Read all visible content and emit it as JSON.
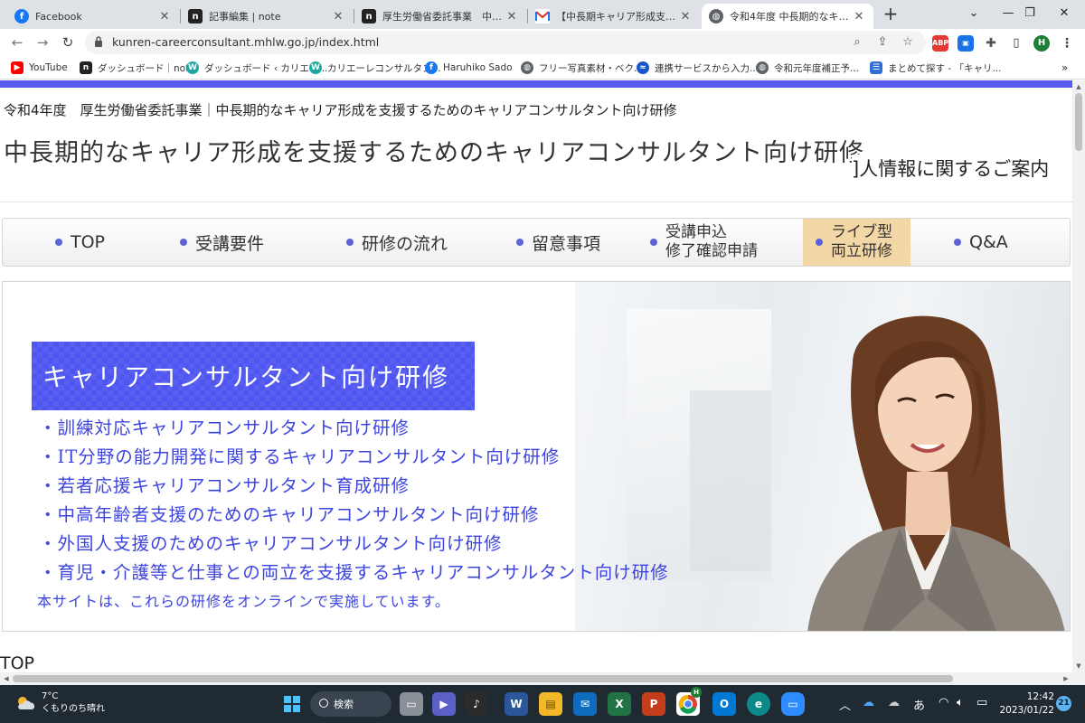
{
  "browser": {
    "tabs": [
      {
        "title": "Facebook",
        "icon": "facebook-icon",
        "color": "#1877f2"
      },
      {
        "title": "記事編集 | note",
        "icon": "note-icon",
        "color": "#222222"
      },
      {
        "title": "厚生労働省委託事業　中長期",
        "icon": "note-icon",
        "color": "#222222"
      },
      {
        "title": "【中長期キャリア形成支援研修】",
        "icon": "gmail-icon",
        "color": "#d93025"
      },
      {
        "title": "令和4年度 中長期的なキャリア",
        "icon": "globe-icon",
        "color": "#5f6368"
      }
    ],
    "active_tab_index": 4,
    "url": "kunren-careerconsultant.mhlw.go.jp/index.html",
    "profile_initial": "H",
    "extension_abp": "ABP",
    "bookmarks": [
      {
        "label": "YouTube",
        "icon": "youtube-icon",
        "color": "#ff0000"
      },
      {
        "label": "ダッシュボード｜note",
        "icon": "note-icon",
        "color": "#222222"
      },
      {
        "label": "ダッシュボード ‹ カリエー...",
        "icon": "wordpress-icon",
        "color": "#20a8a0"
      },
      {
        "label": "カリエーレコンサルタン...",
        "icon": "wordpress-icon",
        "color": "#20a8a0"
      },
      {
        "label": "Haruhiko Sado",
        "icon": "facebook-icon",
        "color": "#1877f2"
      },
      {
        "label": "フリー写真素材・ベク...",
        "icon": "globe-icon",
        "color": "#5f6368"
      },
      {
        "label": "連携サービスから入力...",
        "icon": "service-icon",
        "color": "#1a56c9"
      },
      {
        "label": "令和元年度補正予...",
        "icon": "globe-icon",
        "color": "#5f6368"
      },
      {
        "label": "まとめて探す - 「キャリ...",
        "icon": "search-app-icon",
        "color": "#2f6fd6"
      }
    ]
  },
  "site": {
    "subtitle": "令和4年度　厚生労働省委託事業｜中長期的なキャリア形成を支援するためのキャリアコンサルタント向け研修",
    "title": "中長期的なキャリア形成を支援するためのキャリアコンサルタント向け研修",
    "ticker": "]人情報に関するご案内",
    "accent_color": "#5b5bf0",
    "nav": [
      {
        "label": "TOP"
      },
      {
        "label": "受講要件"
      },
      {
        "label": "研修の流れ"
      },
      {
        "label": "留意事項"
      },
      {
        "line1": "受講申込",
        "line2": "修了確認申請"
      },
      {
        "line1": "ライブ型",
        "line2": "両立研修",
        "highlighted": true
      },
      {
        "label": "Q&A"
      }
    ],
    "hero": {
      "banner": "キャリアコンサルタント向け研修",
      "courses": [
        "・訓練対応キャリアコンサルタント向け研修",
        "・IT分野の能力開発に関するキャリアコンサルタント向け研修",
        "・若者応援キャリアコンサルタント育成研修",
        "・中高年齢者支援のためのキャリアコンサルタント向け研修",
        "・外国人支援のためのキャリアコンサルタント向け研修",
        "・育児・介護等と仕事との両立を支援するキャリアコンサルタント向け研修"
      ],
      "note": "本サイトは、これらの研修をオンラインで実施しています。"
    },
    "section_heading": "TOP"
  },
  "taskbar": {
    "temperature": "7°C",
    "weather": "くもりのち晴れ",
    "search": "検索",
    "ime": "あ",
    "time": "12:42",
    "date": "2023/01/22",
    "notifications": "21",
    "chrome_profile": "H"
  }
}
